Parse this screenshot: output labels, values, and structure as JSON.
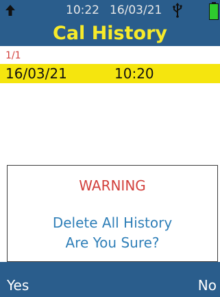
{
  "status_bar": {
    "time": "10:22",
    "date": "16/03/21",
    "icons": [
      "up-arrow-icon",
      "usb-icon",
      "battery-icon"
    ]
  },
  "header": {
    "title": "Cal History"
  },
  "history": {
    "page_indicator": "1/1",
    "rows": [
      {
        "date": "16/03/21",
        "time": "10:20",
        "selected": true
      }
    ]
  },
  "dialog": {
    "title": "WARNING",
    "line1": "Delete All History",
    "line2": "Are You Sure?"
  },
  "softkeys": {
    "left": "Yes",
    "right": "No"
  },
  "colors": {
    "header_bg": "#2a5d8c",
    "title": "#f7ea2a",
    "selected_row": "#f5e50e",
    "warning": "#d2403c",
    "dialog_text": "#2f7fb8",
    "battery": "#2ecc2e"
  }
}
